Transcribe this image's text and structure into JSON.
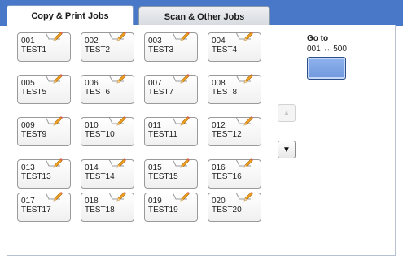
{
  "tabs": {
    "copy_print": "Copy & Print Jobs",
    "scan_other": "Scan & Other Jobs"
  },
  "goto": {
    "label": "Go to",
    "range": "001 ↔ 500"
  },
  "scroll": {
    "up": "▲",
    "down": "▼"
  },
  "icons": {
    "edit": "pencil-icon",
    "scroll_up": "triangle-up-icon",
    "scroll_down": "triangle-down-icon"
  },
  "colors": {
    "header_bar": "#4a78c8",
    "goto_button": "#7fa5e6",
    "pencil": "#f0a020"
  },
  "jobs": [
    {
      "num": "001",
      "name": "TEST1"
    },
    {
      "num": "002",
      "name": "TEST2"
    },
    {
      "num": "003",
      "name": "TEST3"
    },
    {
      "num": "004",
      "name": "TEST4"
    },
    {
      "num": "005",
      "name": "TEST5"
    },
    {
      "num": "006",
      "name": "TEST6"
    },
    {
      "num": "007",
      "name": "TEST7"
    },
    {
      "num": "008",
      "name": "TEST8"
    },
    {
      "num": "009",
      "name": "TEST9"
    },
    {
      "num": "010",
      "name": "TEST10"
    },
    {
      "num": "011",
      "name": "TEST11"
    },
    {
      "num": "012",
      "name": "TEST12"
    },
    {
      "num": "013",
      "name": "TEST13"
    },
    {
      "num": "014",
      "name": "TEST14"
    },
    {
      "num": "015",
      "name": "TEST15"
    },
    {
      "num": "016",
      "name": "TEST16"
    },
    {
      "num": "017",
      "name": "TEST17"
    },
    {
      "num": "018",
      "name": "TEST18"
    },
    {
      "num": "019",
      "name": "TEST19"
    },
    {
      "num": "020",
      "name": "TEST20"
    }
  ]
}
